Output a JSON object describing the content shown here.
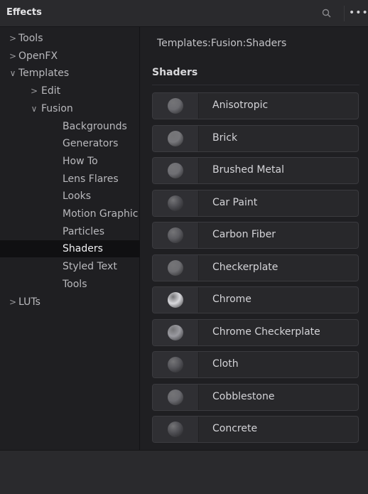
{
  "panel": {
    "title": "Effects"
  },
  "tree": [
    {
      "label": "Tools",
      "chevron": ">",
      "level": 0,
      "selected": false
    },
    {
      "label": "OpenFX",
      "chevron": ">",
      "level": 0,
      "selected": false
    },
    {
      "label": "Templates",
      "chevron": "∨",
      "level": 0,
      "selected": false
    },
    {
      "label": "Edit",
      "chevron": ">",
      "level": 1,
      "selected": false
    },
    {
      "label": "Fusion",
      "chevron": "∨",
      "level": 1,
      "selected": false
    },
    {
      "label": "Backgrounds",
      "chevron": "",
      "level": 2,
      "selected": false
    },
    {
      "label": "Generators",
      "chevron": "",
      "level": 2,
      "selected": false
    },
    {
      "label": "How To",
      "chevron": "",
      "level": 2,
      "selected": false
    },
    {
      "label": "Lens Flares",
      "chevron": "",
      "level": 2,
      "selected": false
    },
    {
      "label": "Looks",
      "chevron": "",
      "level": 2,
      "selected": false
    },
    {
      "label": "Motion Graphic",
      "chevron": "",
      "level": 2,
      "selected": false
    },
    {
      "label": "Particles",
      "chevron": "",
      "level": 2,
      "selected": false
    },
    {
      "label": "Shaders",
      "chevron": "",
      "level": 2,
      "selected": true
    },
    {
      "label": "Styled Text",
      "chevron": "",
      "level": 2,
      "selected": false
    },
    {
      "label": "Tools",
      "chevron": "",
      "level": 2,
      "selected": false
    },
    {
      "label": "LUTs",
      "chevron": ">",
      "level": 0,
      "selected": false
    }
  ],
  "content": {
    "path": "Templates:Fusion:Shaders",
    "section_title": "Shaders",
    "items": [
      {
        "label": "Anisotropic",
        "icon": "anisotropic-shader-icon",
        "color": "#6b6b70"
      },
      {
        "label": "Brick",
        "icon": "brick-shader-icon",
        "color": "#77777b"
      },
      {
        "label": "Brushed Metal",
        "icon": "brushed-metal-shader-icon",
        "color": "#6f6f74"
      },
      {
        "label": "Car Paint",
        "icon": "car-paint-shader-icon",
        "color": "#4d4d52"
      },
      {
        "label": "Carbon Fiber",
        "icon": "carbon-fiber-shader-icon",
        "color": "#5b5b60"
      },
      {
        "label": "Checkerplate",
        "icon": "checkerplate-shader-icon",
        "color": "#6e6e72"
      },
      {
        "label": "Chrome",
        "icon": "chrome-shader-icon",
        "color": "#d8d8dc"
      },
      {
        "label": "Chrome Checkerplate",
        "icon": "chrome-checkerplate-shader-icon",
        "color": "#9a9aa0"
      },
      {
        "label": "Cloth",
        "icon": "cloth-shader-icon",
        "color": "#55555a"
      },
      {
        "label": "Cobblestone",
        "icon": "cobblestone-shader-icon",
        "color": "#6a6a6f"
      },
      {
        "label": "Concrete",
        "icon": "concrete-shader-icon",
        "color": "#4f4f54"
      }
    ]
  }
}
